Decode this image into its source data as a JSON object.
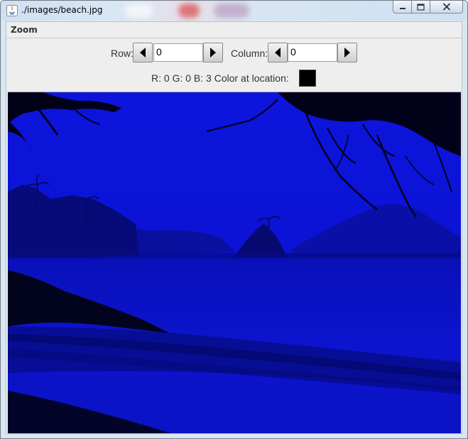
{
  "window": {
    "title": "./images/beach.jpg",
    "icon": "java-icon"
  },
  "menu": {
    "items": [
      "Zoom"
    ]
  },
  "controls": {
    "row_label": "Row:",
    "row_value": "0",
    "column_label": "Column:",
    "column_value": "0",
    "prev_icon": "triangle-left-icon",
    "next_icon": "triangle-right-icon"
  },
  "pixel_info": {
    "text": "R: 0 G: 0 B: 3 Color at location:",
    "swatch_color": "#000003"
  },
  "image": {
    "description_colors": {
      "sky": "#0c12d6",
      "water": "#0b13c8",
      "silhouette": "#02031c"
    }
  }
}
